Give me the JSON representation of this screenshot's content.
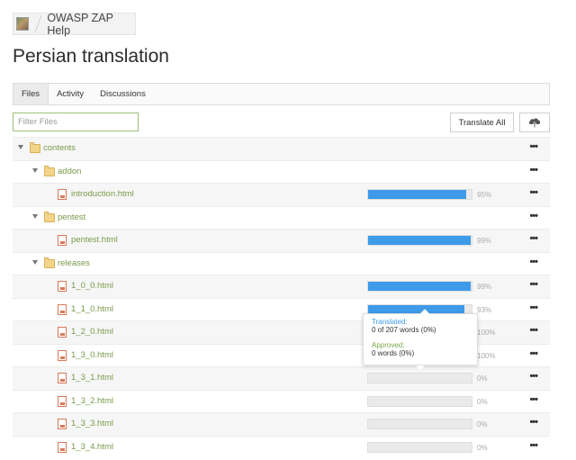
{
  "breadcrumb": {
    "project": "OWASP ZAP Help"
  },
  "page": {
    "title": "Persian translation"
  },
  "tabs": [
    {
      "label": "Files",
      "active": true
    },
    {
      "label": "Activity",
      "active": false
    },
    {
      "label": "Discussions",
      "active": false
    }
  ],
  "filter": {
    "placeholder": "Filter Files",
    "value": ""
  },
  "toolbar": {
    "translate_all": "Translate All",
    "upload_icon": "cloud-upload-icon"
  },
  "colors": {
    "progress": "#3d9be9",
    "file_name": "#7a9a4a",
    "translated": "#3d9be9",
    "approved": "#7aa84a"
  },
  "tree": [
    {
      "name": "contents",
      "type": "folder",
      "depth": 0
    },
    {
      "name": "addon",
      "type": "folder",
      "depth": 1
    },
    {
      "name": "introduction.html",
      "type": "file",
      "depth": 2,
      "progress": 95,
      "pct": "95%"
    },
    {
      "name": "pentest",
      "type": "folder",
      "depth": 1
    },
    {
      "name": "pentest.html",
      "type": "file",
      "depth": 2,
      "progress": 99,
      "pct": "99%"
    },
    {
      "name": "releases",
      "type": "folder",
      "depth": 1
    },
    {
      "name": "1_0_0.html",
      "type": "file",
      "depth": 2,
      "progress": 99,
      "pct": "99%"
    },
    {
      "name": "1_1_0.html",
      "type": "file",
      "depth": 2,
      "progress": 93,
      "pct": "93%"
    },
    {
      "name": "1_2_0.html",
      "type": "file",
      "depth": 2,
      "progress": 100,
      "pct": "100%"
    },
    {
      "name": "1_3_0.html",
      "type": "file",
      "depth": 2,
      "progress": 100,
      "pct": "100%"
    },
    {
      "name": "1_3_1.html",
      "type": "file",
      "depth": 2,
      "progress": 0,
      "pct": "0%"
    },
    {
      "name": "1_3_2.html",
      "type": "file",
      "depth": 2,
      "progress": 0,
      "pct": "0%"
    },
    {
      "name": "1_3_3.html",
      "type": "file",
      "depth": 2,
      "progress": 0,
      "pct": "0%"
    },
    {
      "name": "1_3_4.html",
      "type": "file",
      "depth": 2,
      "progress": 0,
      "pct": "0%"
    }
  ],
  "tooltip": {
    "translated_label": "Translated:",
    "translated_value": "0 of 207 words (0%)",
    "approved_label": "Approved:",
    "approved_value": "0 words (0%)"
  }
}
